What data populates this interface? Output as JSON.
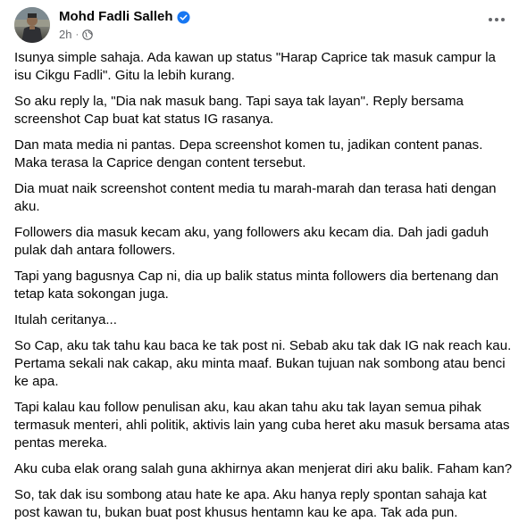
{
  "post": {
    "author": "Mohd Fadli Salleh",
    "time": "2h",
    "separator": "·",
    "verified_icon": "verified-badge-icon",
    "audience_icon": "globe-icon",
    "more_icon": "ellipsis-icon",
    "accent_color": "#1877f2",
    "paragraphs": [
      "Isunya simple sahaja. Ada kawan up status \"Harap Caprice tak masuk campur la isu Cikgu Fadli\". Gitu la lebih kurang.",
      "So aku reply la, \"Dia nak masuk bang. Tapi saya tak layan\". Reply bersama screenshot Cap buat kat status IG rasanya.",
      "Dan mata media ni pantas. Depa screenshot komen tu, jadikan content panas. Maka terasa la Caprice dengan content tersebut.",
      "Dia muat naik screenshot content media tu marah-marah dan terasa hati dengan aku.",
      "Followers dia masuk kecam aku, yang followers aku kecam dia. Dah jadi gaduh pulak dah antara followers.",
      "Tapi yang bagusnya Cap ni, dia up balik status minta followers dia bertenang dan tetap kata sokongan juga.",
      "Itulah ceritanya...",
      "So Cap, aku tak tahu kau baca ke tak post ni. Sebab aku tak dak IG nak reach kau. Pertama sekali nak cakap, aku minta maaf. Bukan tujuan nak sombong atau benci ke apa.",
      "Tapi kalau kau follow penulisan aku, kau akan tahu aku tak layan semua pihak termasuk menteri, ahli politik, aktivis lain yang cuba heret aku masuk bersama atas pentas mereka.",
      "Aku cuba elak orang salah guna akhirnya akan menjerat diri aku balik. Faham kan?",
      "So, tak dak isu sombong atau hate ke apa. Aku hanya reply spontan sahaja kat post kawan tu, bukan buat post khusus hentamn kau ke apa. Tak ada pun."
    ]
  }
}
